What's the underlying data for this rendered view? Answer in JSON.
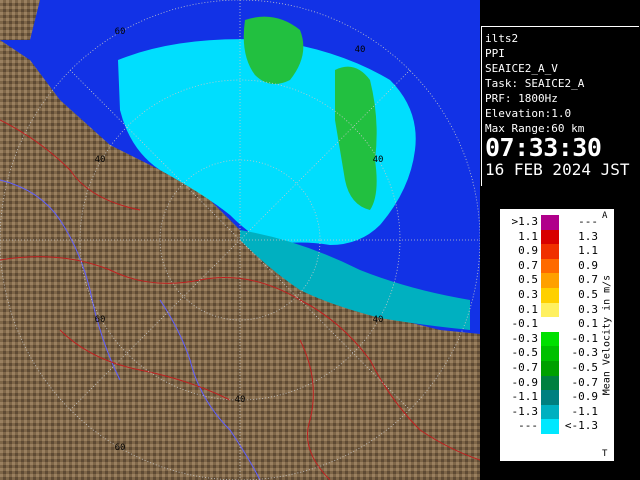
{
  "radar": {
    "station": "ilts2",
    "mode": "PPI",
    "product": "SEAICE2_A_V",
    "task_prefix": "Task: ",
    "task": "SEAICE2_A",
    "prf_prefix": "PRF: ",
    "prf": "1800Hz",
    "elevation_prefix": "Elevation:",
    "elevation": "1.0",
    "max_range_prefix": "Max Range:",
    "max_range": "60 km",
    "time": "07:33:30",
    "date": "16 FEB 2024 JST"
  },
  "range_labels": [
    "60",
    "40",
    "40",
    "40",
    "60",
    "40",
    "40",
    "60"
  ],
  "legend": {
    "title": "Mean Velocity in m/s",
    "top_mark": "A",
    "bottom_mark": "T",
    "rows": [
      {
        "left": ">1.3",
        "right": "---",
        "color": "#b0008a"
      },
      {
        "left": "1.1",
        "right": "1.3",
        "color": "#d80000"
      },
      {
        "left": "0.9",
        "right": "1.1",
        "color": "#f03000"
      },
      {
        "left": "0.7",
        "right": "0.9",
        "color": "#ff6a00"
      },
      {
        "left": "0.5",
        "right": "0.7",
        "color": "#ffa000"
      },
      {
        "left": "0.3",
        "right": "0.5",
        "color": "#ffd000"
      },
      {
        "left": "0.1",
        "right": "0.3",
        "color": "#fff060"
      },
      {
        "left": "-0.1",
        "right": "0.1",
        "color": "#ffffff"
      },
      {
        "left": "-0.3",
        "right": "-0.1",
        "color": "#00e000"
      },
      {
        "left": "-0.5",
        "right": "-0.3",
        "color": "#00c000"
      },
      {
        "left": "-0.7",
        "right": "-0.5",
        "color": "#00a000"
      },
      {
        "left": "-0.9",
        "right": "-0.7",
        "color": "#008040"
      },
      {
        "left": "-1.1",
        "right": "-0.9",
        "color": "#008080"
      },
      {
        "left": "-1.3",
        "right": "-1.1",
        "color": "#00b0c0"
      },
      {
        "left": "---",
        "right": "<-1.3",
        "color": "#00e8ff"
      }
    ]
  },
  "colors": {
    "sea": "#1232e6",
    "echo_near": "#00e8ff",
    "echo_mid": "#00b0c0",
    "echo_green": "#22c040",
    "land": "#7e6648",
    "range_ring": "#c8c8c8",
    "river": "#6060ff",
    "boundary": "#c02020"
  }
}
